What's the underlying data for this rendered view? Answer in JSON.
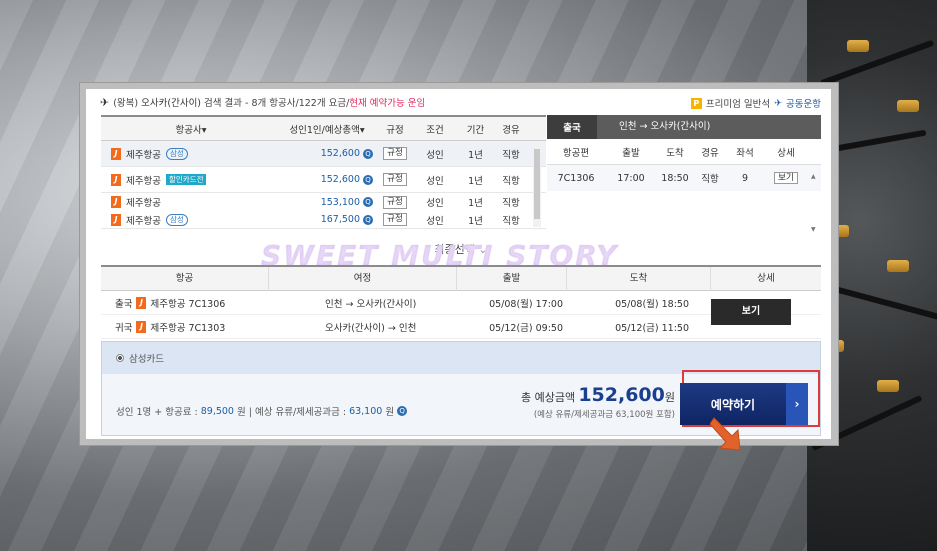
{
  "header": {
    "trip_type": "(왕복)",
    "destination": "오사카(간사이)",
    "summary": "검색 결과 - 8개 항공사/122개 요금/",
    "available": "현재 예약가능 운임",
    "premium": "프리미엄 일반석",
    "codeshare": "공동운항"
  },
  "list": {
    "headers": [
      "항공사▾",
      "성인1인/예상총액▾",
      "규정",
      "조건",
      "기간",
      "경유"
    ],
    "rows": [
      {
        "airline": "제주항공",
        "tag": "삼성",
        "tag_type": "outline",
        "price": "152,600",
        "rule": "규정",
        "cond": "성인",
        "period": "1년",
        "via": "직항"
      },
      {
        "airline": "제주항공",
        "tag": "할인카드전",
        "tag_type": "blue",
        "price": "152,600",
        "rule": "규정",
        "cond": "성인",
        "period": "1년",
        "via": "직항"
      },
      {
        "airline": "제주항공",
        "tag": "",
        "tag_type": "",
        "price": "153,100",
        "rule": "규정",
        "cond": "성인",
        "period": "1년",
        "via": "직항"
      },
      {
        "airline": "제주항공",
        "tag": "삼성",
        "tag_type": "outline",
        "price": "167,500",
        "rule": "규정",
        "cond": "성인",
        "period": "1년",
        "via": "직항"
      }
    ]
  },
  "detail": {
    "direction": "출국",
    "route": "인천 → 오사카(간사이)",
    "headers": [
      "항공편",
      "출발",
      "도착",
      "경유",
      "좌석",
      "상세"
    ],
    "row": {
      "flight": "7C1306",
      "dep": "17:00",
      "arr": "18:50",
      "via": "직항",
      "seats": "9",
      "view": "보기"
    }
  },
  "final": {
    "title": "최종선택",
    "watermark": "SWEET MULTI STORY",
    "headers": [
      "항공",
      "여정",
      "출발",
      "도착",
      "상세"
    ],
    "rows": [
      {
        "dir": "출국",
        "flight": "제주항공 7C1306",
        "from": "인천",
        "to": "오사카(간사이)",
        "dep": "05/08(월) 17:00",
        "arr": "05/08(월) 18:50"
      },
      {
        "dir": "귀국",
        "flight": "제주항공 7C1303",
        "from": "오사카(간사이)",
        "to": "인천",
        "dep": "05/12(금) 09:50",
        "arr": "05/12(금) 11:50"
      }
    ],
    "view_button": "보기"
  },
  "payment": {
    "card": "삼성카드",
    "fare_prefix": "성인 1명 + 항공료 :",
    "fare": "89,500",
    "fare_suffix": "원 | 예상 유류/제세공과금 :",
    "tax": "63,100",
    "tax_suffix": "원",
    "total_label": "총 예상금액",
    "total": "152,600",
    "won": "원",
    "total_note": "(예상 유류/제세공과금 63,100원 포함)",
    "book_button": "예약하기"
  }
}
